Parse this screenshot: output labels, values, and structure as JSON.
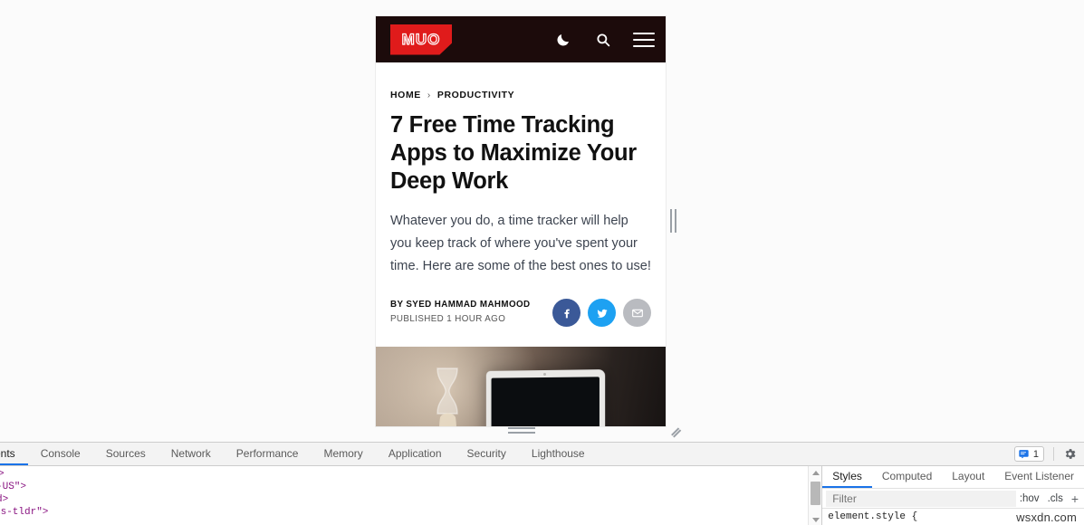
{
  "site": {
    "logo_text": "MUO",
    "header_icons": [
      {
        "name": "dark-mode-icon",
        "label": "Dark mode"
      },
      {
        "name": "search-icon",
        "label": "Search"
      },
      {
        "name": "menu-icon",
        "label": "Menu"
      }
    ]
  },
  "article": {
    "breadcrumb": {
      "home": "HOME",
      "separator": "›",
      "category": "PRODUCTIVITY"
    },
    "headline": "7 Free Time Tracking Apps to Maximize Your Deep Work",
    "dek": "Whatever you do, a time tracker will help you keep track of where you've spent your time. Here are some of the best ones to use!",
    "author_line": "BY SYED HAMMAD MAHMOOD",
    "published_line": "PUBLISHED 1 HOUR AGO",
    "share": [
      {
        "name": "facebook-share-button",
        "label": "f",
        "color": "#3b5998"
      },
      {
        "name": "twitter-share-button",
        "label": "t",
        "color": "#1da1f2"
      },
      {
        "name": "email-share-button",
        "label": "m",
        "color": "#b9bbc0"
      }
    ]
  },
  "devtools": {
    "tabs": [
      {
        "label": "ents",
        "active": true
      },
      {
        "label": "Console",
        "active": false
      },
      {
        "label": "Sources",
        "active": false
      },
      {
        "label": "Network",
        "active": false
      },
      {
        "label": "Performance",
        "active": false
      },
      {
        "label": "Memory",
        "active": false
      },
      {
        "label": "Application",
        "active": false
      },
      {
        "label": "Security",
        "active": false
      },
      {
        "label": "Lighthouse",
        "active": false
      }
    ],
    "message_count": "1",
    "dom_lines": [
      ">",
      "-US\">",
      "d>",
      "is-tldr\">"
    ],
    "styles": {
      "tabs": [
        {
          "label": "Styles",
          "active": true
        },
        {
          "label": "Computed",
          "active": false
        },
        {
          "label": "Layout",
          "active": false
        },
        {
          "label": "Event Listener",
          "active": false
        }
      ],
      "filter_placeholder": "Filter",
      "hov_label": ":hov",
      "cls_label": ".cls",
      "plus_label": "+",
      "rule_text": "element.style {"
    }
  },
  "watermark": "wsxdn.com"
}
